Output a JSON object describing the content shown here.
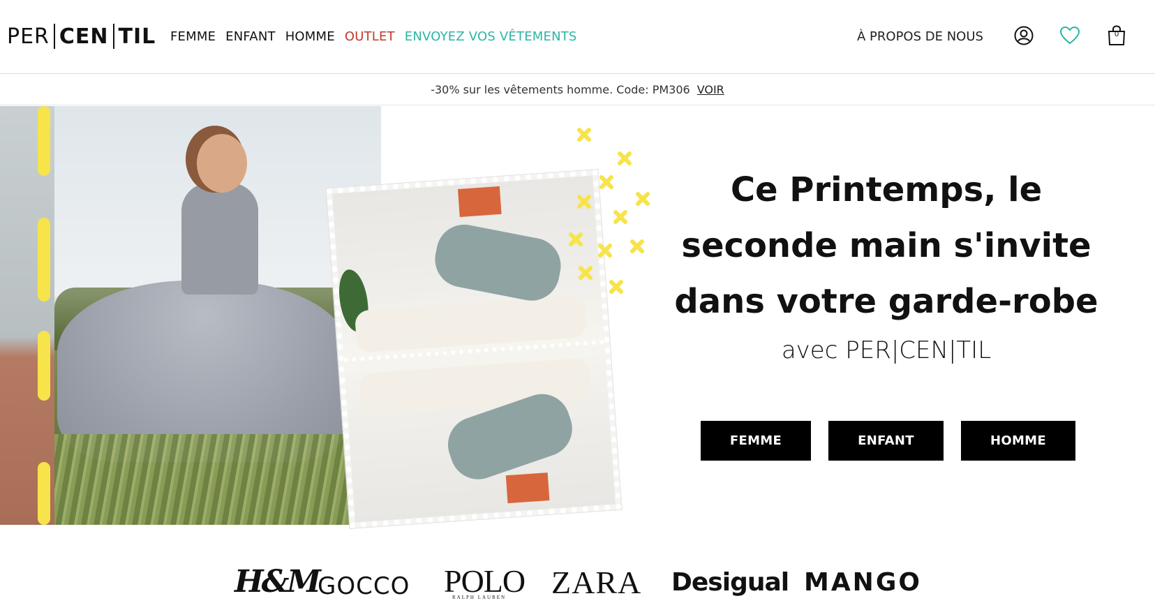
{
  "logo": {
    "part1": "PER",
    "part2": "CEN",
    "part3": "TIL"
  },
  "nav": {
    "items": [
      {
        "label": "FEMME"
      },
      {
        "label": "ENFANT"
      },
      {
        "label": "HOMME"
      },
      {
        "label": "OUTLET"
      },
      {
        "label": "ENVOYEZ VOS VÊTEMENTS"
      }
    ],
    "about": "À PROPOS DE NOUS",
    "cart_count": "0"
  },
  "icons": {
    "account": "user-circle-icon",
    "wishlist": "heart-icon",
    "cart": "shopping-bag-icon"
  },
  "colors": {
    "outlet": "#c0392b",
    "send": "#2bb5a5",
    "accent_yellow": "#f7e34a",
    "button_bg": "#000000"
  },
  "promo": {
    "text": "-30% sur les vêtements homme. Code: PM306",
    "link": "VOIR"
  },
  "hero": {
    "headline_l1": "Ce Printemps, le",
    "headline_l2": "seconde main s'invite",
    "headline_l3": "dans votre garde-robe",
    "subline": "avec PER|CEN|TIL",
    "buttons": [
      "FEMME",
      "ENFANT",
      "HOMME"
    ]
  },
  "brands": [
    "H&M",
    "GOCCO",
    "POLO",
    "RALPH LAUREN",
    "ZARA",
    "Desigual",
    "MANGO"
  ]
}
